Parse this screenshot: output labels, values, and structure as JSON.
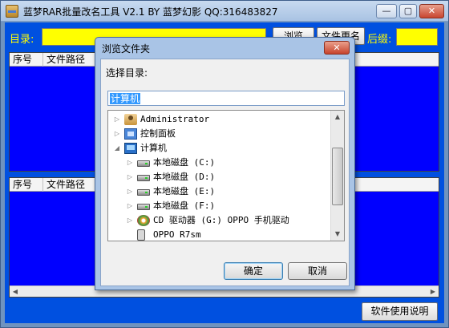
{
  "window": {
    "title": "蓝梦RAR批量改名工具 V2.1 BY 蓝梦幻影 QQ:316483827",
    "minimize": "—",
    "maximize": "▢",
    "close": "✕"
  },
  "toolbar": {
    "dir_label": "目录:",
    "dir_value": "",
    "browse_button": "浏览",
    "rename_button": "文件更名",
    "suffix_label": "后缀:",
    "suffix_value": ""
  },
  "list_top": {
    "columns": [
      "序号",
      "文件路径"
    ]
  },
  "list_bottom": {
    "columns": [
      "序号",
      "文件路径"
    ]
  },
  "footer": {
    "help_button": "软件使用说明"
  },
  "dialog": {
    "title": "浏览文件夹",
    "close": "✕",
    "prompt": "选择目录:",
    "path_value": "计算机",
    "tree": [
      {
        "label": "Administrator",
        "icon": "user-folder-icon",
        "expand": "▷"
      },
      {
        "label": "控制面板",
        "icon": "control-panel-icon",
        "expand": "▷"
      },
      {
        "label": "计算机",
        "icon": "computer-icon",
        "expand": "◢"
      },
      {
        "label": "本地磁盘 (C:)",
        "icon": "hard-disk-icon",
        "expand": "▷"
      },
      {
        "label": "本地磁盘 (D:)",
        "icon": "hard-disk-icon",
        "expand": "▷"
      },
      {
        "label": "本地磁盘 (E:)",
        "icon": "hard-disk-icon",
        "expand": "▷"
      },
      {
        "label": "本地磁盘 (F:)",
        "icon": "hard-disk-icon",
        "expand": "▷"
      },
      {
        "label": "CD 驱动器 (G:) OPPO 手机驱动",
        "icon": "cd-drive-icon",
        "expand": "▷"
      },
      {
        "label": "OPPO R7sm",
        "icon": "phone-icon",
        "expand": ""
      }
    ],
    "ok_button": "确定",
    "cancel_button": "取消"
  }
}
